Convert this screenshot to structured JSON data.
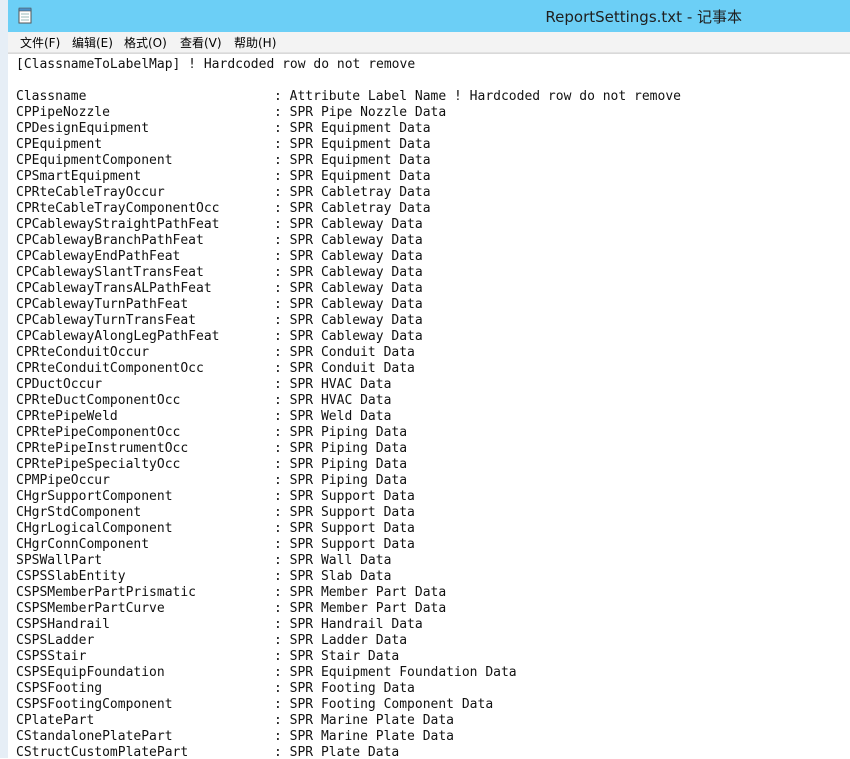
{
  "window": {
    "title": "ReportSettings.txt - 记事本",
    "icon": "notepad-icon"
  },
  "menu": [
    {
      "label": "文件(F)"
    },
    {
      "label": "编辑(E)"
    },
    {
      "label": "格式(O)"
    },
    {
      "label": "查看(V)"
    },
    {
      "label": "帮助(H)"
    }
  ],
  "document": {
    "header": "[ClassnameToLabelMap] ! Hardcoded row do not remove",
    "rows": [
      {
        "a": "Classname",
        "b": ": Attribute Label Name ! Hardcoded row do not remove"
      },
      {
        "a": "CPPipeNozzle",
        "b": ": SPR Pipe Nozzle Data"
      },
      {
        "a": "CPDesignEquipment",
        "b": ": SPR Equipment Data"
      },
      {
        "a": "CPEquipment",
        "b": ": SPR Equipment Data"
      },
      {
        "a": "CPEquipmentComponent",
        "b": ": SPR Equipment Data"
      },
      {
        "a": "CPSmartEquipment",
        "b": ": SPR Equipment Data"
      },
      {
        "a": "CPRteCableTrayOccur",
        "b": ": SPR Cabletray Data"
      },
      {
        "a": "CPRteCableTrayComponentOcc",
        "b": ": SPR Cabletray Data"
      },
      {
        "a": "CPCablewayStraightPathFeat",
        "b": ": SPR Cableway Data"
      },
      {
        "a": "CPCablewayBranchPathFeat",
        "b": ": SPR Cableway Data"
      },
      {
        "a": "CPCablewayEndPathFeat",
        "b": ": SPR Cableway Data"
      },
      {
        "a": "CPCablewaySlantTransFeat",
        "b": ": SPR Cableway Data"
      },
      {
        "a": "CPCablewayTransALPathFeat",
        "b": ": SPR Cableway Data"
      },
      {
        "a": "CPCablewayTurnPathFeat",
        "b": ": SPR Cableway Data"
      },
      {
        "a": "CPCablewayTurnTransFeat",
        "b": ": SPR Cableway Data"
      },
      {
        "a": "CPCablewayAlongLegPathFeat",
        "b": ": SPR Cableway Data"
      },
      {
        "a": "CPRteConduitOccur",
        "b": ": SPR Conduit Data"
      },
      {
        "a": "CPRteConduitComponentOcc",
        "b": ": SPR Conduit Data"
      },
      {
        "a": "CPDuctOccur",
        "b": ": SPR HVAC Data"
      },
      {
        "a": "CPRteDuctComponentOcc",
        "b": ": SPR HVAC Data"
      },
      {
        "a": "CPRtePipeWeld",
        "b": ": SPR Weld Data"
      },
      {
        "a": "CPRtePipeComponentOcc",
        "b": ": SPR Piping Data"
      },
      {
        "a": "CPRtePipeInstrumentOcc",
        "b": ": SPR Piping Data"
      },
      {
        "a": "CPRtePipeSpecialtyOcc",
        "b": ": SPR Piping Data"
      },
      {
        "a": "CPMPipeOccur",
        "b": ": SPR Piping Data"
      },
      {
        "a": "CHgrSupportComponent",
        "b": ": SPR Support Data"
      },
      {
        "a": "CHgrStdComponent",
        "b": ": SPR Support Data"
      },
      {
        "a": "CHgrLogicalComponent",
        "b": ": SPR Support Data"
      },
      {
        "a": "CHgrConnComponent",
        "b": ": SPR Support Data"
      },
      {
        "a": "SPSWallPart",
        "b": ": SPR Wall Data"
      },
      {
        "a": "CSPSSlabEntity",
        "b": ": SPR Slab Data"
      },
      {
        "a": "CSPSMemberPartPrismatic",
        "b": ": SPR Member Part Data"
      },
      {
        "a": "CSPSMemberPartCurve",
        "b": ": SPR Member Part Data"
      },
      {
        "a": "CSPSHandrail",
        "b": ": SPR Handrail Data"
      },
      {
        "a": "CSPSLadder",
        "b": ": SPR Ladder Data"
      },
      {
        "a": "CSPSStair",
        "b": ": SPR Stair Data"
      },
      {
        "a": "CSPSEquipFoundation",
        "b": ": SPR Equipment Foundation Data"
      },
      {
        "a": "CSPSFooting",
        "b": ": SPR Footing Data"
      },
      {
        "a": "CSPSFootingComponent",
        "b": ": SPR Footing Component Data"
      },
      {
        "a": "CPlatePart",
        "b": ": SPR Marine Plate Data"
      },
      {
        "a": "CStandalonePlatePart",
        "b": ": SPR Marine Plate Data"
      },
      {
        "a": "CStructCustomPlatePart",
        "b": ": SPR Plate Data"
      }
    ]
  }
}
